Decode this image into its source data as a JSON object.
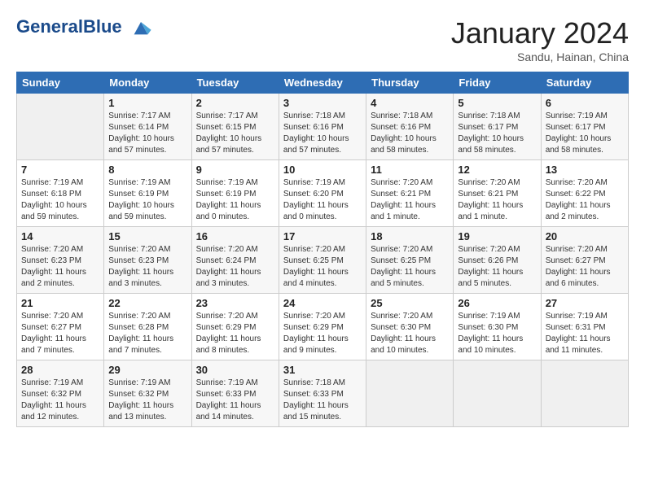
{
  "header": {
    "logo_line1": "General",
    "logo_line2": "Blue",
    "title": "January 2024",
    "location": "Sandu, Hainan, China"
  },
  "calendar": {
    "headers": [
      "Sunday",
      "Monday",
      "Tuesday",
      "Wednesday",
      "Thursday",
      "Friday",
      "Saturday"
    ],
    "weeks": [
      [
        {
          "day": "",
          "info": ""
        },
        {
          "day": "1",
          "info": "Sunrise: 7:17 AM\nSunset: 6:14 PM\nDaylight: 10 hours\nand 57 minutes."
        },
        {
          "day": "2",
          "info": "Sunrise: 7:17 AM\nSunset: 6:15 PM\nDaylight: 10 hours\nand 57 minutes."
        },
        {
          "day": "3",
          "info": "Sunrise: 7:18 AM\nSunset: 6:16 PM\nDaylight: 10 hours\nand 57 minutes."
        },
        {
          "day": "4",
          "info": "Sunrise: 7:18 AM\nSunset: 6:16 PM\nDaylight: 10 hours\nand 58 minutes."
        },
        {
          "day": "5",
          "info": "Sunrise: 7:18 AM\nSunset: 6:17 PM\nDaylight: 10 hours\nand 58 minutes."
        },
        {
          "day": "6",
          "info": "Sunrise: 7:19 AM\nSunset: 6:17 PM\nDaylight: 10 hours\nand 58 minutes."
        }
      ],
      [
        {
          "day": "7",
          "info": "Sunrise: 7:19 AM\nSunset: 6:18 PM\nDaylight: 10 hours\nand 59 minutes."
        },
        {
          "day": "8",
          "info": "Sunrise: 7:19 AM\nSunset: 6:19 PM\nDaylight: 10 hours\nand 59 minutes."
        },
        {
          "day": "9",
          "info": "Sunrise: 7:19 AM\nSunset: 6:19 PM\nDaylight: 11 hours\nand 0 minutes."
        },
        {
          "day": "10",
          "info": "Sunrise: 7:19 AM\nSunset: 6:20 PM\nDaylight: 11 hours\nand 0 minutes."
        },
        {
          "day": "11",
          "info": "Sunrise: 7:20 AM\nSunset: 6:21 PM\nDaylight: 11 hours\nand 1 minute."
        },
        {
          "day": "12",
          "info": "Sunrise: 7:20 AM\nSunset: 6:21 PM\nDaylight: 11 hours\nand 1 minute."
        },
        {
          "day": "13",
          "info": "Sunrise: 7:20 AM\nSunset: 6:22 PM\nDaylight: 11 hours\nand 2 minutes."
        }
      ],
      [
        {
          "day": "14",
          "info": "Sunrise: 7:20 AM\nSunset: 6:23 PM\nDaylight: 11 hours\nand 2 minutes."
        },
        {
          "day": "15",
          "info": "Sunrise: 7:20 AM\nSunset: 6:23 PM\nDaylight: 11 hours\nand 3 minutes."
        },
        {
          "day": "16",
          "info": "Sunrise: 7:20 AM\nSunset: 6:24 PM\nDaylight: 11 hours\nand 3 minutes."
        },
        {
          "day": "17",
          "info": "Sunrise: 7:20 AM\nSunset: 6:25 PM\nDaylight: 11 hours\nand 4 minutes."
        },
        {
          "day": "18",
          "info": "Sunrise: 7:20 AM\nSunset: 6:25 PM\nDaylight: 11 hours\nand 5 minutes."
        },
        {
          "day": "19",
          "info": "Sunrise: 7:20 AM\nSunset: 6:26 PM\nDaylight: 11 hours\nand 5 minutes."
        },
        {
          "day": "20",
          "info": "Sunrise: 7:20 AM\nSunset: 6:27 PM\nDaylight: 11 hours\nand 6 minutes."
        }
      ],
      [
        {
          "day": "21",
          "info": "Sunrise: 7:20 AM\nSunset: 6:27 PM\nDaylight: 11 hours\nand 7 minutes."
        },
        {
          "day": "22",
          "info": "Sunrise: 7:20 AM\nSunset: 6:28 PM\nDaylight: 11 hours\nand 7 minutes."
        },
        {
          "day": "23",
          "info": "Sunrise: 7:20 AM\nSunset: 6:29 PM\nDaylight: 11 hours\nand 8 minutes."
        },
        {
          "day": "24",
          "info": "Sunrise: 7:20 AM\nSunset: 6:29 PM\nDaylight: 11 hours\nand 9 minutes."
        },
        {
          "day": "25",
          "info": "Sunrise: 7:20 AM\nSunset: 6:30 PM\nDaylight: 11 hours\nand 10 minutes."
        },
        {
          "day": "26",
          "info": "Sunrise: 7:19 AM\nSunset: 6:30 PM\nDaylight: 11 hours\nand 10 minutes."
        },
        {
          "day": "27",
          "info": "Sunrise: 7:19 AM\nSunset: 6:31 PM\nDaylight: 11 hours\nand 11 minutes."
        }
      ],
      [
        {
          "day": "28",
          "info": "Sunrise: 7:19 AM\nSunset: 6:32 PM\nDaylight: 11 hours\nand 12 minutes."
        },
        {
          "day": "29",
          "info": "Sunrise: 7:19 AM\nSunset: 6:32 PM\nDaylight: 11 hours\nand 13 minutes."
        },
        {
          "day": "30",
          "info": "Sunrise: 7:19 AM\nSunset: 6:33 PM\nDaylight: 11 hours\nand 14 minutes."
        },
        {
          "day": "31",
          "info": "Sunrise: 7:18 AM\nSunset: 6:33 PM\nDaylight: 11 hours\nand 15 minutes."
        },
        {
          "day": "",
          "info": ""
        },
        {
          "day": "",
          "info": ""
        },
        {
          "day": "",
          "info": ""
        }
      ]
    ]
  }
}
